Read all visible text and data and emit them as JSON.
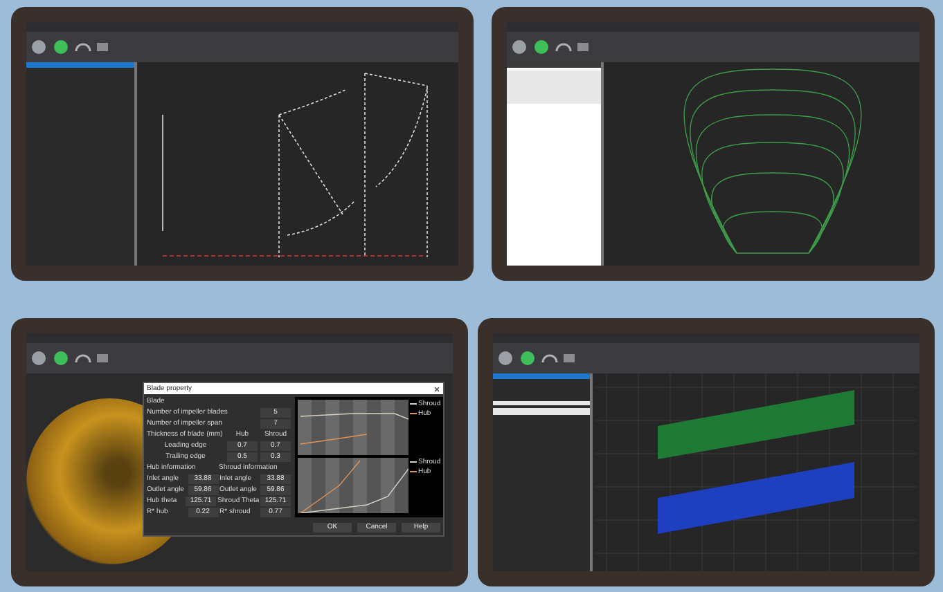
{
  "screens": [
    {
      "kind": "sketch"
    },
    {
      "kind": "arcs"
    },
    {
      "kind": "dialog",
      "dialog": {
        "title": "Blade property",
        "section": "Blade",
        "fields": [
          {
            "label": "Number of impeller blades",
            "value": "5"
          },
          {
            "label": "Number of impeller span",
            "value": "7"
          }
        ],
        "thickness": {
          "header": "Thickness of blade (mm)",
          "columns": [
            "Hub",
            "Shroud"
          ],
          "rows": [
            {
              "label": "Leading edge",
              "values": [
                "0.7",
                "0.7"
              ]
            },
            {
              "label": "Trailing edge",
              "values": [
                "0.5",
                "0.3"
              ]
            }
          ]
        },
        "info": {
          "headers": [
            "Hub information",
            "Shroud information"
          ],
          "rows": [
            [
              {
                "label": "Inlet angle",
                "value": "33.88"
              },
              {
                "label": "Inlet angle",
                "value": "33.88"
              }
            ],
            [
              {
                "label": "Outlet angle",
                "value": "59.86"
              },
              {
                "label": "Outlet angle",
                "value": "59.86"
              }
            ],
            [
              {
                "label": "Hub theta",
                "value": "125.71"
              },
              {
                "label": "Shroud Theta",
                "value": "125.71"
              }
            ],
            [
              {
                "label": "R* hub",
                "value": "0.22"
              },
              {
                "label": "R* shroud",
                "value": "0.77"
              }
            ]
          ]
        },
        "charts": [
          {
            "legend": [
              {
                "name": "Shroud",
                "color": "#d9d2c4"
              },
              {
                "name": "Hub",
                "color": "#e0955a"
              }
            ]
          },
          {
            "legend": [
              {
                "name": "Shroud",
                "color": "#d9d2c4"
              },
              {
                "name": "Hub",
                "color": "#e0955a"
              }
            ]
          }
        ],
        "buttons": [
          "OK",
          "Cancel",
          "Help"
        ]
      }
    },
    {
      "kind": "bands"
    }
  ]
}
